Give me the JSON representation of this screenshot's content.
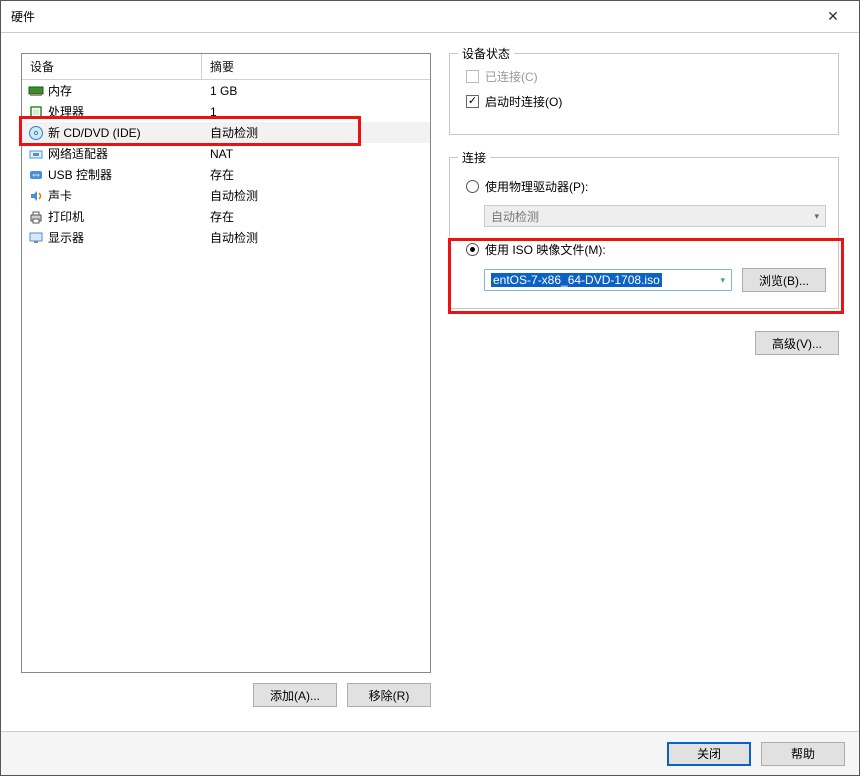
{
  "title": "硬件",
  "device_table": {
    "headers": {
      "col1": "设备",
      "col2": "摘要"
    },
    "rows": [
      {
        "icon": "memory-icon",
        "name": "内存",
        "summary": "1 GB"
      },
      {
        "icon": "cpu-icon",
        "name": "处理器",
        "summary": "1"
      },
      {
        "icon": "disc-icon",
        "name": "新 CD/DVD (IDE)",
        "summary": "自动检测",
        "selected": true
      },
      {
        "icon": "network-icon",
        "name": "网络适配器",
        "summary": "NAT"
      },
      {
        "icon": "usb-icon",
        "name": "USB 控制器",
        "summary": "存在"
      },
      {
        "icon": "sound-icon",
        "name": "声卡",
        "summary": "自动检测"
      },
      {
        "icon": "printer-icon",
        "name": "打印机",
        "summary": "存在"
      },
      {
        "icon": "monitor-icon",
        "name": "显示器",
        "summary": "自动检测"
      }
    ]
  },
  "left_buttons": {
    "add": "添加(A)...",
    "remove": "移除(R)"
  },
  "device_status": {
    "legend": "设备状态",
    "connected": "已连接(C)",
    "connect_at_power_on": "启动时连接(O)"
  },
  "connection": {
    "legend": "连接",
    "use_physical": "使用物理驱动器(P):",
    "physical_value": "自动检测",
    "use_iso": "使用 ISO 映像文件(M):",
    "iso_value": "entOS-7-x86_64-DVD-1708.iso",
    "browse": "浏览(B)..."
  },
  "advanced": "高级(V)...",
  "footer": {
    "close": "关闭",
    "help": "帮助"
  }
}
